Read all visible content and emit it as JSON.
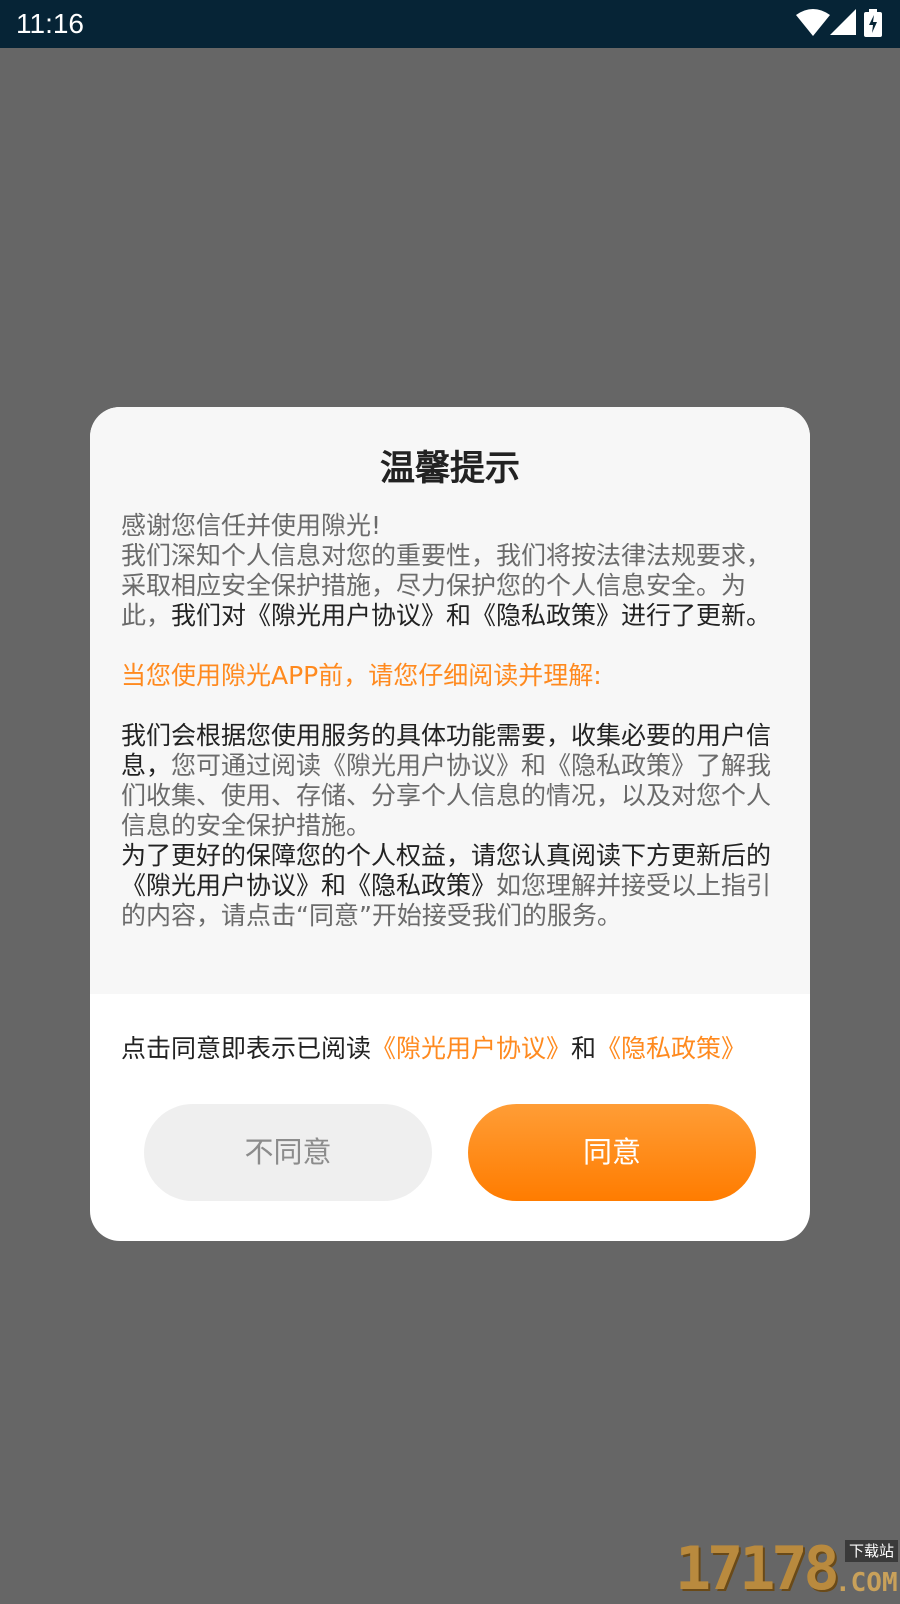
{
  "status_bar": {
    "time": "11:16",
    "icons": [
      "wifi-icon",
      "cell-signal-icon",
      "battery-charging-icon"
    ]
  },
  "dialog": {
    "title": "温馨提示",
    "para1": {
      "line_intro": "感谢您信任并使用隙光!",
      "text_a": "我们深知个人信息对您的重要性，我们将按法律法规要求，采取相应安全保护措施，尽力保护您的个人信息安全。为此，",
      "text_b": "我们对《隙光用户协议》和《隐私政策》进行了更新。"
    },
    "notice": "当您使用隙光APP前，请您仔细阅读并理解:",
    "para2": {
      "text_a": "我们会根据您使用服务的具体功能需要，收集必要的用户信息，",
      "text_b": "您可通过阅读《隙光用户协议》和《隐私政策》了解我们收集、使用、存储、分享个人信息的情况，以及对您个人信息的安全保护措施。",
      "text_c": "为了更好的保障您的个人权益，请您认真阅读下方更新后的《隙光用户协议》和《隐私政策》",
      "text_d": "如您理解并接受以上指引的内容，请点击“同意”开始接受我们的服务。"
    },
    "agree_line": {
      "prefix": "点击同意即表示已阅读",
      "user_agreement_link": "《隙光用户协议》",
      "and": "和",
      "privacy_link": "《隐私政策》"
    },
    "buttons": {
      "decline": "不同意",
      "agree": "同意"
    }
  },
  "watermark": {
    "number": "17178",
    "sub": "下载站",
    "com": ".COM"
  },
  "colors": {
    "accent": "#ff8a1f",
    "status_bar": "#062436",
    "overlay": "#666666"
  }
}
